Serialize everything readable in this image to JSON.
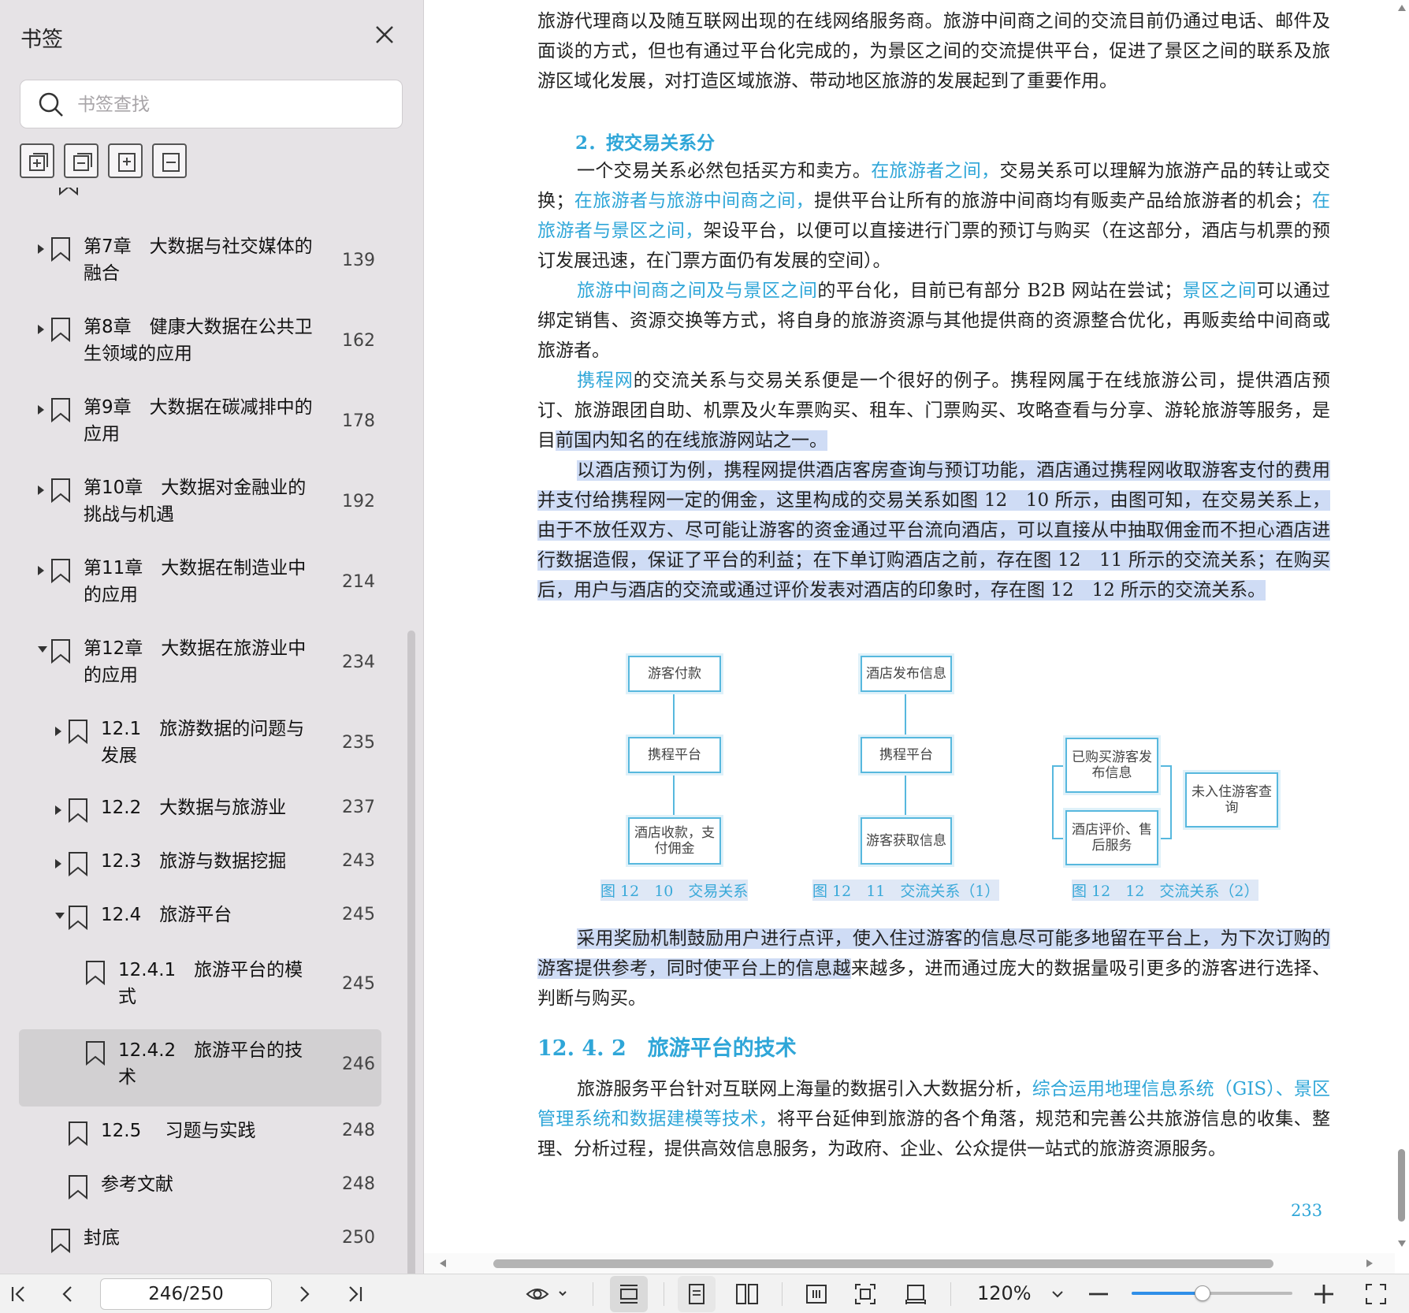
{
  "sidebar": {
    "title": "书签",
    "search_placeholder": "书签查找",
    "toc": [
      {
        "label": "第7章　大数据与社交媒体的\n融合",
        "page": "139",
        "expand": "right"
      },
      {
        "label": "第8章　健康大数据在公共卫\n生领域的应用",
        "page": "162",
        "expand": "right"
      },
      {
        "label": "第9章　大数据在碳减排中的\n应用",
        "page": "178",
        "expand": "right"
      },
      {
        "label": "第10章　大数据对金融业的\n挑战与机遇",
        "page": "192",
        "expand": "right"
      },
      {
        "label": "第11章　大数据在制造业中\n的应用",
        "page": "214",
        "expand": "right"
      },
      {
        "label": "第12章　大数据在旅游业中\n的应用",
        "page": "234",
        "expand": "down"
      },
      {
        "label": "12.1　旅游数据的问题与\n发展",
        "page": "235",
        "expand": "right"
      },
      {
        "label": "12.2　大数据与旅游业",
        "page": "237",
        "expand": "right"
      },
      {
        "label": "12.3　旅游与数据挖掘",
        "page": "243",
        "expand": "right"
      },
      {
        "label": "12.4　旅游平台",
        "page": "245",
        "expand": "down"
      },
      {
        "label": "12.4.1　旅游平台的模\n式",
        "page": "245",
        "expand": "none"
      },
      {
        "label": "12.4.2　旅游平台的技\n术",
        "page": "246",
        "expand": "none"
      },
      {
        "label": "12.5　 习题与实践",
        "page": "248",
        "expand": "none"
      },
      {
        "label": "参考文献",
        "page": "248",
        "expand": "none"
      },
      {
        "label": "封底",
        "page": "250",
        "expand": "none"
      }
    ]
  },
  "document": {
    "p1": "旅游代理商以及随互联网出现的在线网络服务商。旅游中间商之间的交流目前仍通过电话、邮件及面谈的方式，但也有通过平台化完成的，为景区之间的交流提供平台，促进了景区之间的联系及旅游区域化发展，对打造区域旅游、带动地区旅游的发展起到了重要作用。",
    "h_trade": "2．按交易关系分",
    "p2_a": "一个交易关系必然包括买方和卖方。",
    "p2_l1": "在旅游者之间，",
    "p2_b": "交易关系可以理解为旅游产品的转让或交换；",
    "p2_l2": "在旅游者与旅游中间商之间，",
    "p2_c": "提供平台让所有的旅游中间商均有贩卖产品给旅游者的机会；",
    "p2_l3": "在旅游者与景区之间，",
    "p2_d": "架设平台，以便可以直接进行门票的预订与购买（在这部分，酒店与机票的预订发展迅速，在门票方面仍有发展的空间）。",
    "p3_l1": "旅游中间商之间及与景区之间",
    "p3_a": "的平台化，目前已有部分 B2B 网站在尝试；",
    "p3_l2": "景区之间",
    "p3_b": "可以通过绑定销售、资源交换等方式，将自身的旅游资源与其他提供商的资源整合优化，再贩卖给中间商或旅游者。",
    "p4_l1": "携程网",
    "p4_a": "的交流关系与交易关系便是一个很好的例子。携程网属于在线旅游公司，提供酒店预订、旅游跟团自助、机票及火车票购买、租车、门票购买、攻略查看与分享、游轮旅游等服务，是目",
    "p4_hl": "前国内知名的在线旅游网站之一。",
    "p5": "以酒店预订为例，携程网提供酒店客房查询与预订功能，酒店通过携程网收取游客支付的费用并支付给携程网一定的佣金，这里构成的交易关系如图 12　10 所示，由图可知，在交易关系上，由于不放任双方、尽可能让游客的资金通过平台流向酒店，可以直接从中抽取佣金而不担心酒店进行数据造假，保证了平台的利益；在下单订购酒店之前，存在图 12　11 所示的交流关系；在购买后，用户与酒店的交流或通过评价发表对酒店的印象时，存在图 12　12 所示的交流关系。",
    "fig1": {
      "box1": "游客付款",
      "box2": "携程平台",
      "box3": "酒店收款，支付佣金",
      "caption": "图 12　10　交易关系"
    },
    "fig2": {
      "box1": "酒店发布信息",
      "box2": "携程平台",
      "box3": "游客获取信息",
      "caption": "图 12　11　交流关系（1）"
    },
    "fig3": {
      "box1": "已购买游客发布信息",
      "box2": "酒店评价、售后服务",
      "box3": "未入住游客查询",
      "caption": "图 12　12　交流关系（2）"
    },
    "p6_hl": "采用奖励机制鼓励用户进行点评，使入住过游客的信息尽可能多地留在平台上，为下次订购的游客提供参考，同时使平台上的信息越",
    "p6_b": "来越多，进而通过庞大的数据量吸引更多的游客进行选择、判断与购买。",
    "h_section": "12. 4. 2　旅游平台的技术",
    "p7_a": "旅游服务平台针对互联网上海量的数据引入大数据分析，",
    "p7_l1": "综合运用地理信息系统（GIS）、景区管理系统和数据建模等技术，",
    "p7_b": "将平台延伸到旅游的各个角落，规范和完善公共旅游信息的收集、整理、分析过程，提供高效信息服务，为政府、企业、公众提供一站式的旅游资源服务。",
    "page_number": "233"
  },
  "toolbar": {
    "page_value": "246/250",
    "zoom_label": "120%",
    "zoom_fraction": 0.44
  }
}
